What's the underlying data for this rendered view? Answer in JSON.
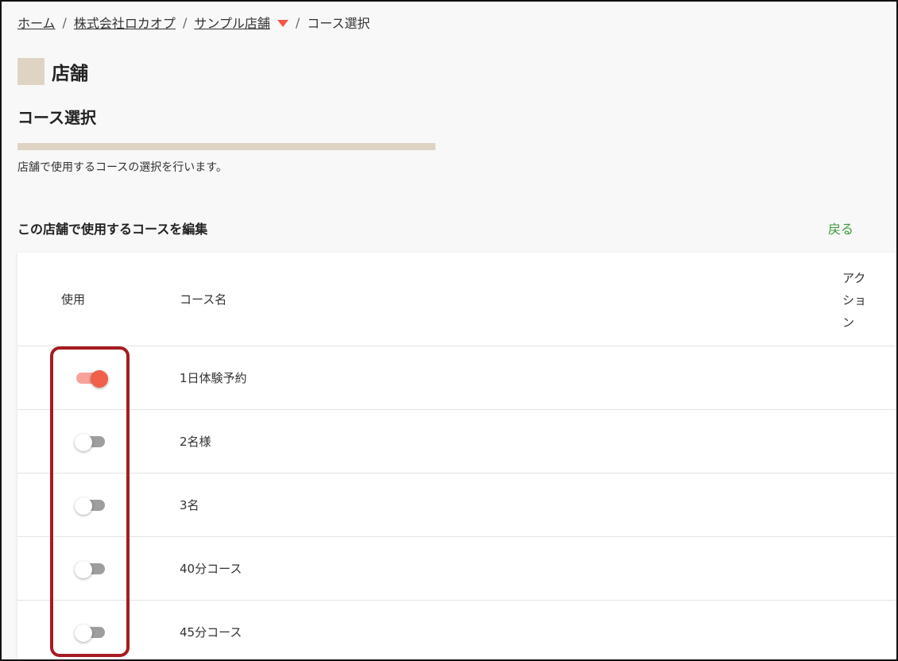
{
  "breadcrumb": {
    "home": "ホーム",
    "company": "株式会社ロカオプ",
    "store": "サンプル店舗",
    "current": "コース選択",
    "separator": "/"
  },
  "header": {
    "title": "店舗",
    "subtitle": "コース選択",
    "description": "店舗で使用するコースの選択を行います。"
  },
  "section": {
    "title": "この店舗で使用するコースを編集",
    "back_label": "戻る"
  },
  "table": {
    "columns": {
      "use": "使用",
      "name": "コース名",
      "action": "アクション"
    },
    "rows": [
      {
        "name": "1日体験予約",
        "enabled": true
      },
      {
        "name": "2名様",
        "enabled": false
      },
      {
        "name": "3名",
        "enabled": false
      },
      {
        "name": "40分コース",
        "enabled": false
      },
      {
        "name": "45分コース",
        "enabled": false
      }
    ]
  },
  "colors": {
    "accent": "#f0604a",
    "accent_light": "#f7a39a",
    "heading_box": "#dfd4c4",
    "link_green": "#3a9a3a",
    "highlight": "#a61b21"
  }
}
